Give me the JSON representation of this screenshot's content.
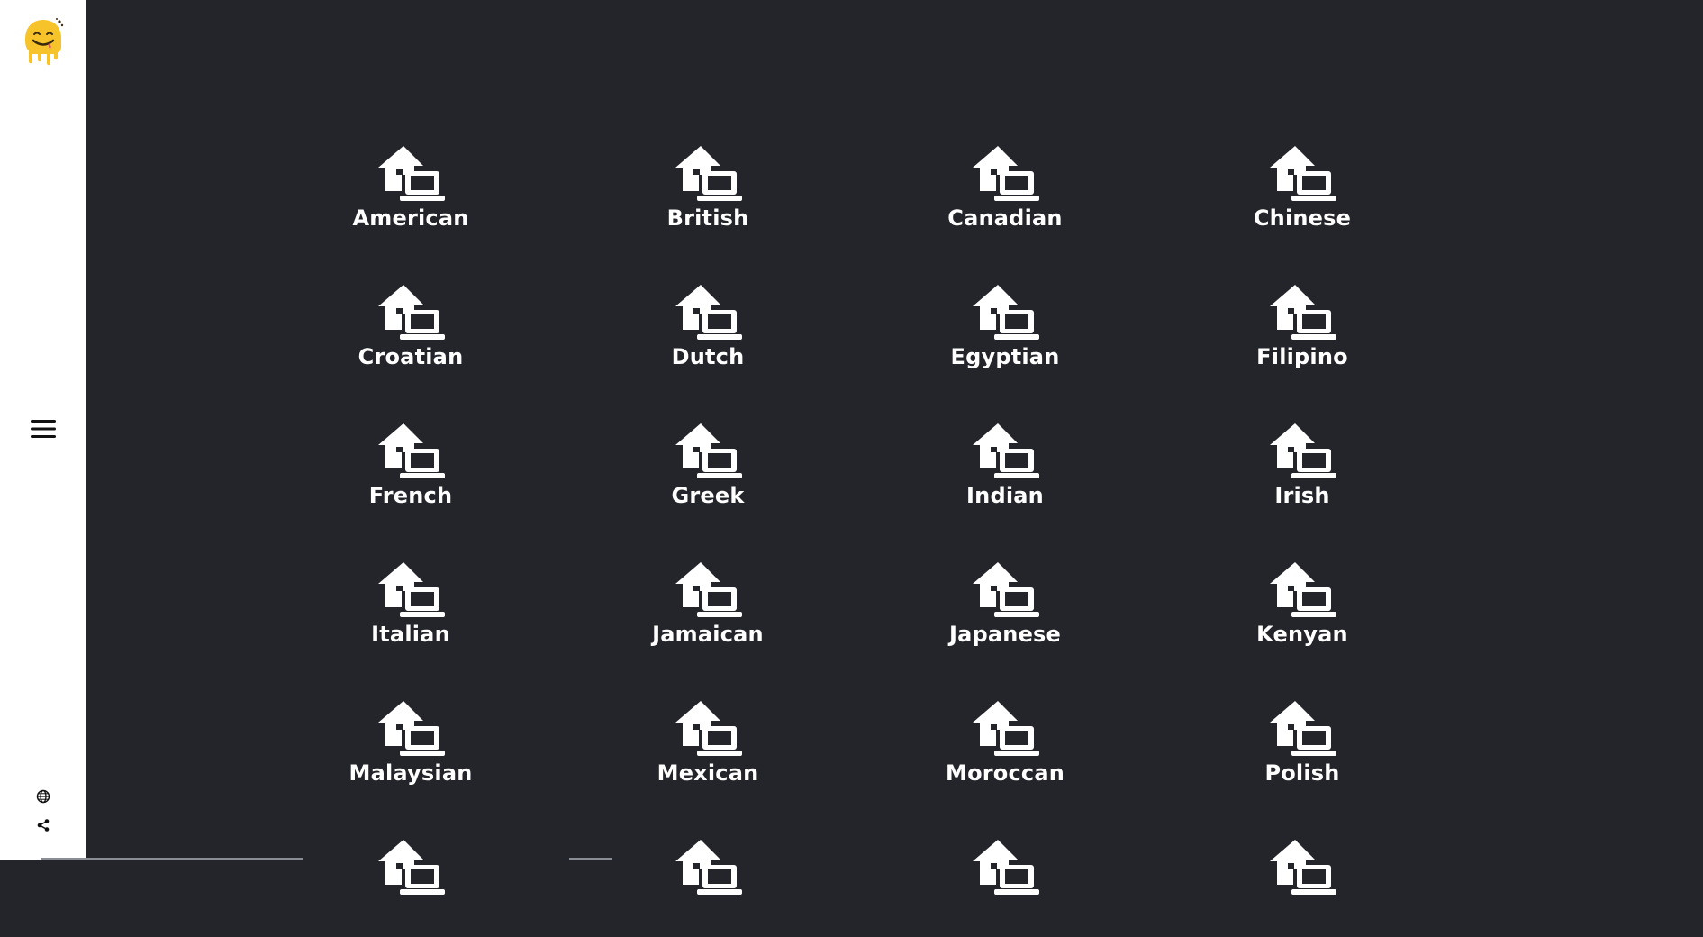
{
  "sidebar": {
    "logo_icon": "smiling-face-logo-icon",
    "menu_icon": "hamburger-menu-icon",
    "language_icon": "globe-icon",
    "share_icon": "share-icon"
  },
  "colors": {
    "background": "#23252a",
    "sidebar": "#ffffff",
    "icon": "#ffffff",
    "logo_yellow": "#f6c42a"
  },
  "tile_icon": "home-laptop-icon",
  "categories": [
    "American",
    "British",
    "Canadian",
    "Chinese",
    "Croatian",
    "Dutch",
    "Egyptian",
    "Filipino",
    "French",
    "Greek",
    "Indian",
    "Irish",
    "Italian",
    "Jamaican",
    "Japanese",
    "Kenyan",
    "Malaysian",
    "Mexican",
    "Moroccan",
    "Polish"
  ]
}
